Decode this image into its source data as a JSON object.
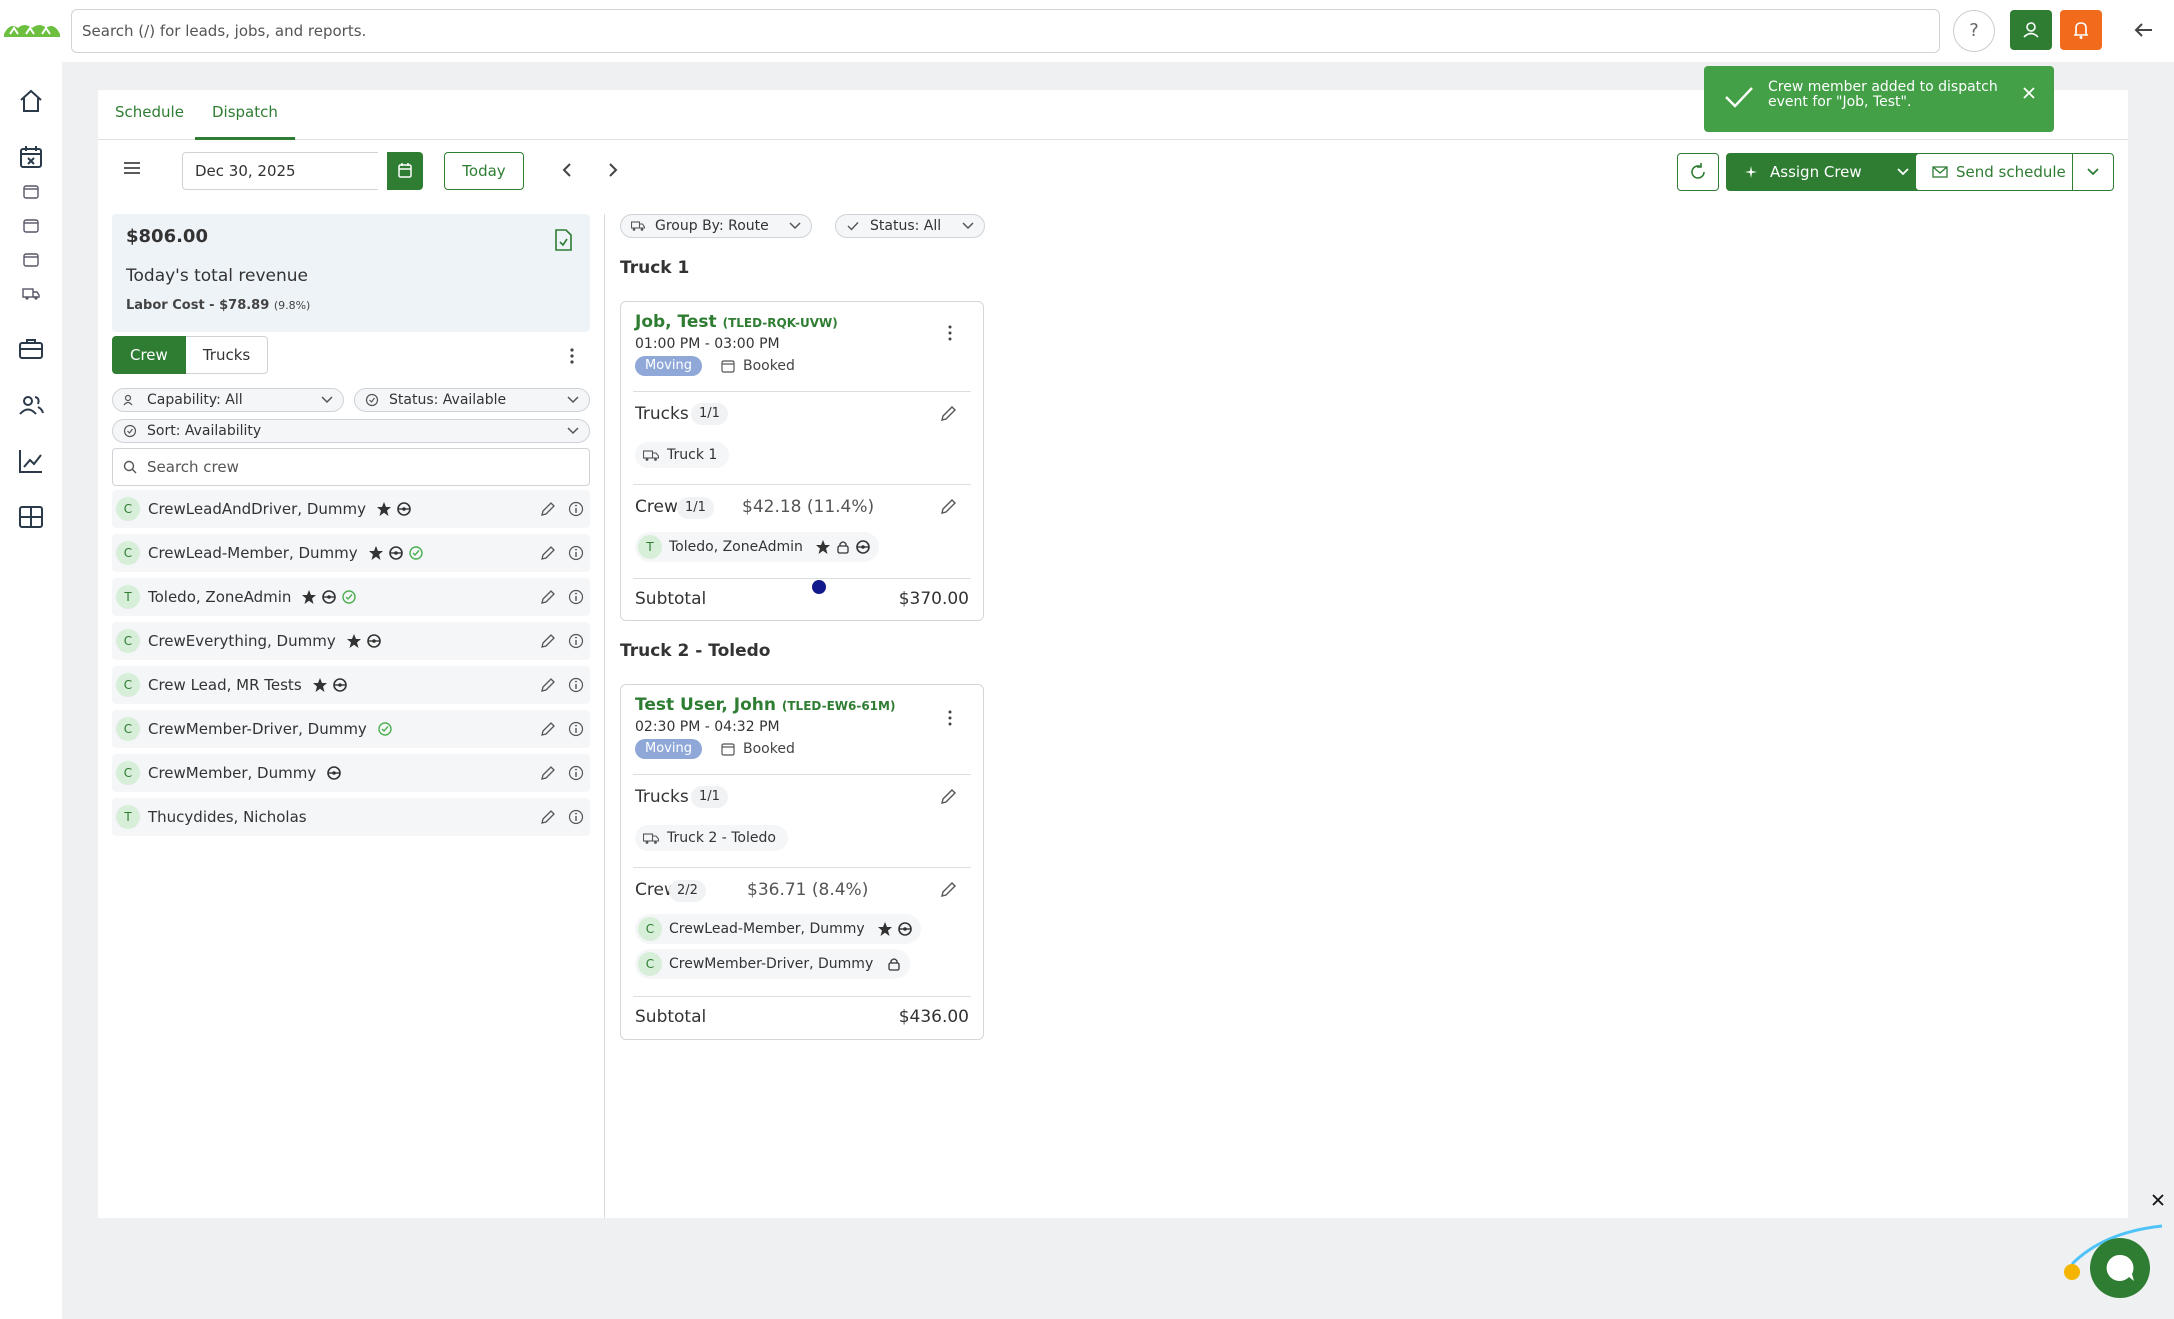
{
  "header": {
    "search_placeholder": "Search (/) for leads, jobs, and reports.",
    "help_label": "?"
  },
  "tabs": [
    {
      "label": "Schedule",
      "active": false
    },
    {
      "label": "Dispatch",
      "active": true
    }
  ],
  "toolbar": {
    "date_value": "Dec 30, 2025",
    "today_label": "Today",
    "assign_crew_label": "Assign Crew",
    "send_schedule_label": "Send schedule"
  },
  "toast": {
    "message": "Crew member added to dispatch event for \"Job, Test\"."
  },
  "revenue": {
    "amount": "$806.00",
    "label": "Today's total revenue",
    "labor_cost": "Labor Cost - $78.89",
    "labor_pct": "(9.8%)"
  },
  "crew_panel": {
    "crew_tab": "Crew",
    "trucks_tab": "Trucks",
    "capability_filter": "Capability: All",
    "status_filter": "Status: Available",
    "sort_filter": "Sort: Availability",
    "search_placeholder": "Search crew",
    "members": [
      {
        "initial": "C",
        "name": "CrewLeadAndDriver, Dummy",
        "badges": [
          "star-icon",
          "steering-wheel-icon"
        ]
      },
      {
        "initial": "C",
        "name": "CrewLead-Member, Dummy",
        "badges": [
          "star-icon",
          "steering-wheel-icon",
          "check-circle-icon"
        ]
      },
      {
        "initial": "T",
        "name": "Toledo, ZoneAdmin",
        "badges": [
          "star-icon",
          "steering-wheel-icon",
          "check-circle-icon"
        ]
      },
      {
        "initial": "C",
        "name": "CrewEverything, Dummy",
        "badges": [
          "star-icon",
          "steering-wheel-icon"
        ]
      },
      {
        "initial": "C",
        "name": "Crew Lead, MR Tests",
        "badges": [
          "star-icon",
          "steering-wheel-icon"
        ]
      },
      {
        "initial": "C",
        "name": "CrewMember-Driver, Dummy",
        "badges": [
          "check-circle-icon"
        ]
      },
      {
        "initial": "C",
        "name": "CrewMember, Dummy",
        "badges": [
          "steering-wheel-icon"
        ]
      },
      {
        "initial": "T",
        "name": "Thucydides, Nicholas",
        "badges": []
      }
    ]
  },
  "dispatch": {
    "group_by": "Group By: Route",
    "status": "Status: All",
    "routes": [
      {
        "title": "Truck 1",
        "job": {
          "name": "Job, Test",
          "code": "(TLED-RQK-UVW)",
          "time": "01:00 PM - 03:00 PM",
          "tag": "Moving",
          "status": "Booked",
          "trucks_label": "Trucks",
          "trucks_count": "1/1",
          "trucks": [
            "Truck 1"
          ],
          "crew_label": "Crew",
          "crew_count": "1/1",
          "crew_cost": "$42.18 (11.4%)",
          "crew": [
            {
              "initial": "T",
              "name": "Toledo, ZoneAdmin"
            }
          ],
          "subtotal_label": "Subtotal",
          "subtotal": "$370.00"
        }
      },
      {
        "title": "Truck 2 - Toledo",
        "job": {
          "name": "Test User, John",
          "code": "(TLED-EW6-61M)",
          "time": "02:30 PM - 04:32 PM",
          "tag": "Moving",
          "status": "Booked",
          "trucks_label": "Trucks",
          "trucks_count": "1/1",
          "trucks": [
            "Truck 2 - Toledo"
          ],
          "crew_label": "Crew",
          "crew_count": "2/2",
          "crew_cost": "$36.71 (8.4%)",
          "crew": [
            {
              "initial": "C",
              "name": "CrewLead-Member, Dummy"
            },
            {
              "initial": "C",
              "name": "CrewMember-Driver, Dummy"
            }
          ],
          "subtotal_label": "Subtotal",
          "subtotal": "$436.00"
        }
      }
    ]
  },
  "colors": {
    "primary": "#2e7d32",
    "toast": "#43a047",
    "notify": "#f26b1d",
    "tag": "#8fa8d8"
  }
}
